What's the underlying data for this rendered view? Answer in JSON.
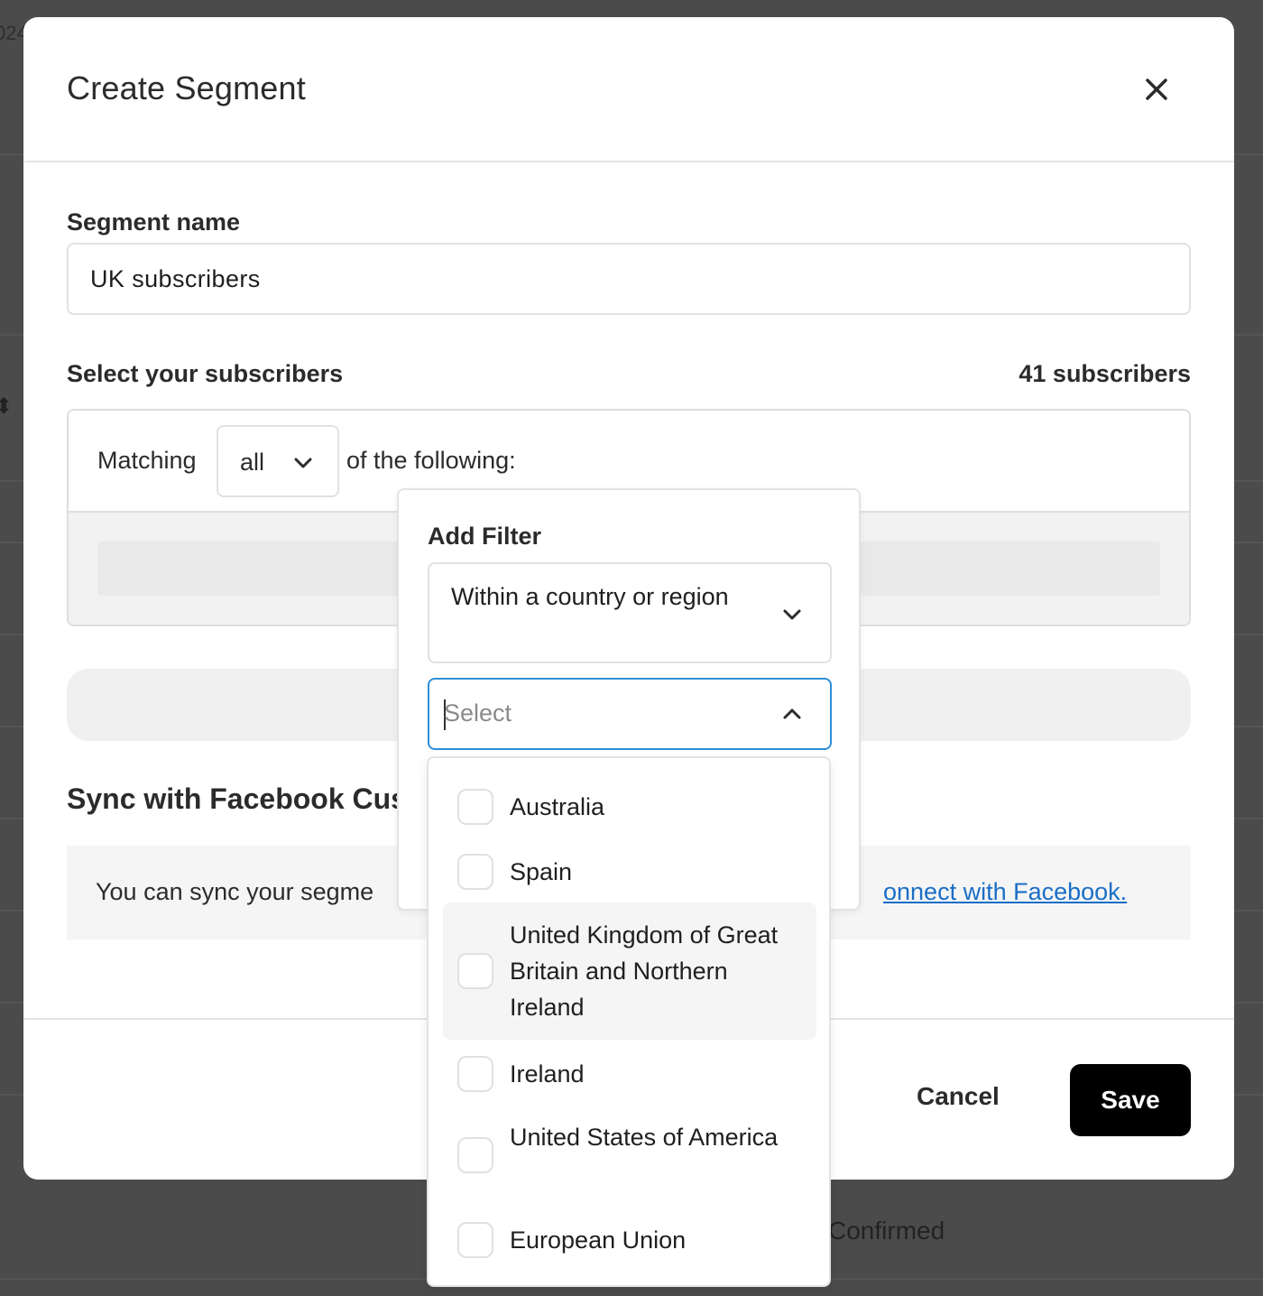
{
  "background": {
    "year_fragment": "024",
    "status_text": "Confirmed"
  },
  "modal": {
    "title": "Create Segment",
    "close_icon": "close-icon",
    "segment_name_label": "Segment name",
    "segment_name_value": "UK subscribers",
    "select_label": "Select your subscribers",
    "subscriber_count": "41 subscribers",
    "matching_prefix": "Matching",
    "matching_value": "all",
    "matching_suffix": "of the following:",
    "facebook_title": "Sync with Facebook Cus",
    "facebook_text": "You can sync your segme",
    "facebook_link": "onnect with Facebook.",
    "cancel_label": "Cancel",
    "save_label": "Save"
  },
  "filter_popover": {
    "title": "Add Filter",
    "filter_type": "Within a country or region",
    "country_placeholder": "Select",
    "options": [
      {
        "label": "Australia",
        "checked": false
      },
      {
        "label": "Spain",
        "checked": false
      },
      {
        "label": "United Kingdom of Great Britain and Northern Ireland",
        "checked": false,
        "hovered": true
      },
      {
        "label": "Ireland",
        "checked": false
      },
      {
        "label": "United States of America",
        "checked": false
      },
      {
        "label": "European Union",
        "checked": false
      }
    ]
  },
  "colors": {
    "overlay": "#4b4b4b",
    "accent_focus": "#2f8fd6",
    "link": "#1a6ec7",
    "primary_button": "#000000"
  }
}
